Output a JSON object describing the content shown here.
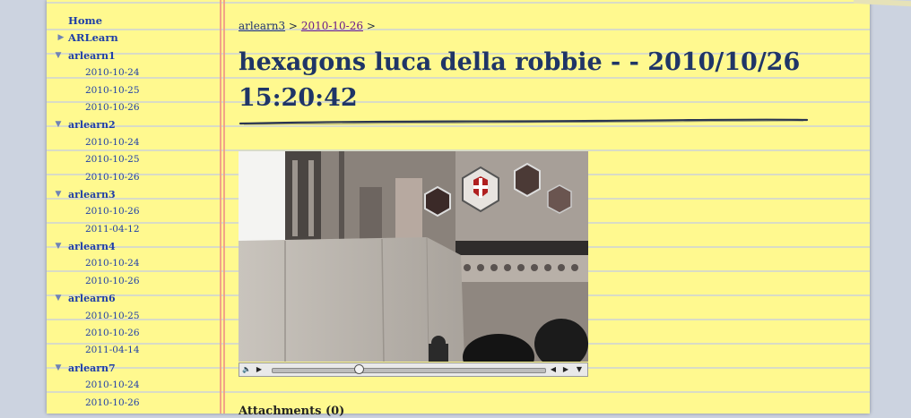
{
  "sidebar": {
    "top": [
      {
        "label": "Home",
        "icon": "none"
      },
      {
        "label": "ARLearn",
        "icon": "chevron-right-icon"
      }
    ],
    "groups": [
      {
        "label": "arlearn1",
        "dates": [
          "2010-10-24",
          "2010-10-25",
          "2010-10-26"
        ]
      },
      {
        "label": "arlearn2",
        "dates": [
          "2010-10-24",
          "2010-10-25",
          "2010-10-26"
        ]
      },
      {
        "label": "arlearn3",
        "dates": [
          "2010-10-26",
          "2011-04-12"
        ]
      },
      {
        "label": "arlearn4",
        "dates": [
          "2010-10-24",
          "2010-10-26"
        ]
      },
      {
        "label": "arlearn6",
        "dates": [
          "2010-10-25",
          "2010-10-26",
          "2011-04-14"
        ]
      },
      {
        "label": "arlearn7",
        "dates": [
          "2010-10-24",
          "2010-10-26"
        ]
      }
    ]
  },
  "breadcrumb": {
    "item1": "arlearn3",
    "sep1": ">",
    "item2": "2010-10-26",
    "sep2": ">"
  },
  "page_title": "hexagons luca della robbie - - 2010/10/26 15:20:42",
  "player": {
    "progress": 0.32
  },
  "attachments_heading": "Attachments (0)",
  "colors": {
    "paper": "#fff98f",
    "margin_line": "#f2a487",
    "link": "#1e3ea8",
    "title": "#1f3567",
    "background": "#ccd3e0"
  }
}
